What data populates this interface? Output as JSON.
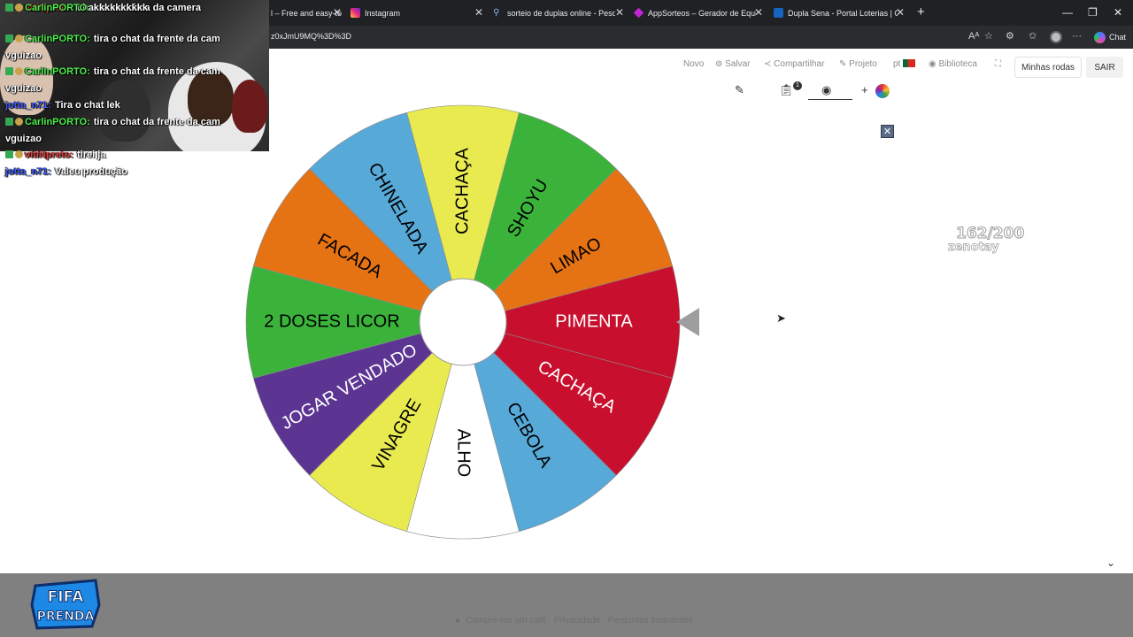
{
  "browser": {
    "tabs": [
      {
        "title": "l – Free and easy-to",
        "icon_color": "#4285f4"
      },
      {
        "title": "Instagram",
        "icon_color": "#e1306c"
      },
      {
        "title": "sorteio de duplas online - Pesquis",
        "icon_color": "#8ab4f8"
      },
      {
        "title": "AppSorteos – Gerador de Equipes",
        "icon_color": "#c026d3"
      },
      {
        "title": "Dupla Sena - Portal Loterias | CAIX",
        "icon_color": "#1565c0"
      }
    ],
    "url": "z0xJmU9MQ%3D%3D",
    "chat_label": "Chat"
  },
  "nav": {
    "novo": "Novo",
    "salvar": "Salvar",
    "compartilhar": "Compartilhar",
    "projeto": "Projeto",
    "lang": "pt",
    "biblioteca": "Biblioteca",
    "minhas_rodas": "Minhas rodas",
    "sair": "SAIR",
    "notes_badge": "1"
  },
  "wheel": {
    "segments": [
      {
        "label": "PIMENTA",
        "color": "#c8102e",
        "text_color": "#ffffff"
      },
      {
        "label": "CACHAÇA",
        "color": "#c8102e",
        "text_color": "#ffffff"
      },
      {
        "label": "CEBOLA",
        "color": "#57a9d8",
        "text_color": "#000000"
      },
      {
        "label": "ALHO",
        "color": "#ffffff",
        "text_color": "#000000"
      },
      {
        "label": "VINAGRE",
        "color": "#e8ea4f",
        "text_color": "#000000"
      },
      {
        "label": "JOGAR VENDADO",
        "color": "#5c3593",
        "text_color": "#ffffff"
      },
      {
        "label": "2 DOSES LICOR",
        "color": "#3bb33b",
        "text_color": "#000000"
      },
      {
        "label": "FACADA",
        "color": "#e57314",
        "text_color": "#000000"
      },
      {
        "label": "CHINELADA",
        "color": "#57a9d8",
        "text_color": "#000000"
      },
      {
        "label": "CACHAÇA",
        "color": "#e8ea4f",
        "text_color": "#000000"
      },
      {
        "label": "SHOYU",
        "color": "#3bb33b",
        "text_color": "#000000"
      },
      {
        "label": "LIMAO",
        "color": "#e57314",
        "text_color": "#000000"
      }
    ]
  },
  "counter": {
    "value": "162/200",
    "user": "zenotay"
  },
  "footer": {
    "links": [
      "Compre-me um café",
      "Privacidade",
      "Perguntas frequentes"
    ],
    "logo_text": [
      "FIFA",
      "PRENDA"
    ]
  },
  "chat": [
    {
      "user": "vitiNpreto",
      "user_color": "#e04040",
      "text": "chat ta em cima da camera",
      "badges": true
    },
    {
      "user": "CarlinPORTO",
      "user_color": "#4ef04e",
      "text": "tira o chat da frente da cam vguizao",
      "badges": true
    },
    {
      "user": "CarlinPORTO",
      "user_color": "#4ef04e",
      "text": "tira o chat da frente da cam vguizao",
      "badges": true
    },
    {
      "user": "jotta_n71",
      "user_color": "#3b5bff",
      "text": "Tira o chat lek",
      "badges": false
    },
    {
      "user": "CarlinPORTO",
      "user_color": "#4ef04e",
      "text": "tira o chat da frente da cam vguizao",
      "badges": true
    },
    {
      "user": "vitiNpreto",
      "user_color": "#e04040",
      "text": "tirei ja",
      "badges": true
    },
    {
      "user": "jotta_n71",
      "user_color": "#3b5bff",
      "text": "Valeu produção",
      "badges": false
    },
    {
      "user": "CarlinPORTO",
      "user_color": "#4ef04e",
      "text": "kkkkkkkkkk",
      "badges": true
    }
  ]
}
